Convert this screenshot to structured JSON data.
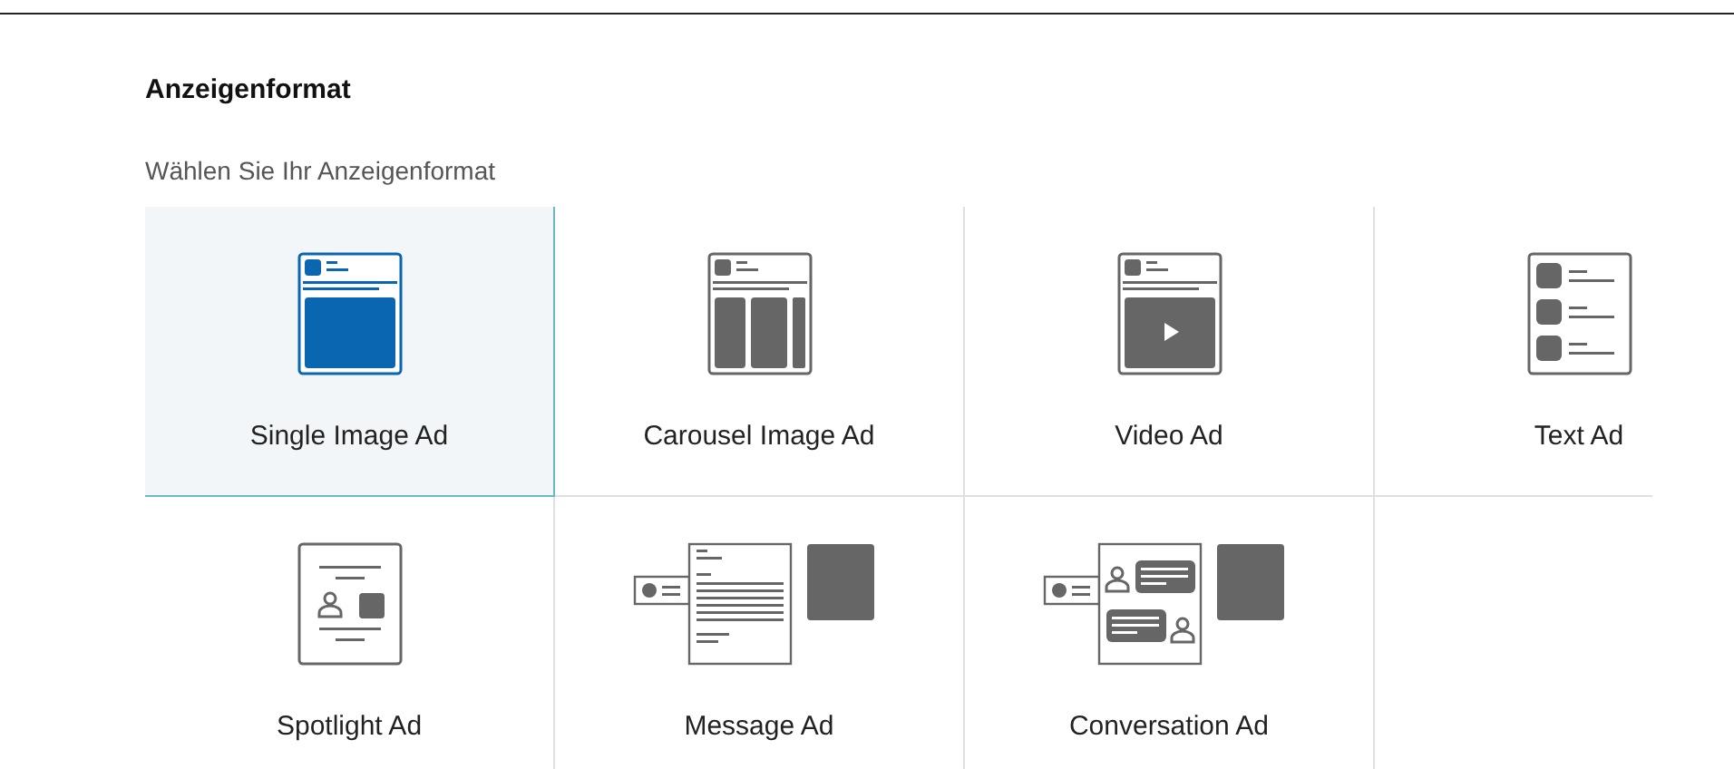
{
  "section": {
    "title": "Anzeigenformat",
    "subtitle": "Wählen Sie Ihr Anzeigenformat"
  },
  "formats": [
    {
      "kind": "single",
      "label": "Single Image Ad",
      "selected": true
    },
    {
      "kind": "carousel",
      "label": "Carousel Image Ad",
      "selected": false
    },
    {
      "kind": "video",
      "label": "Video Ad",
      "selected": false
    },
    {
      "kind": "text",
      "label": "Text Ad",
      "selected": false
    },
    {
      "kind": "spotlight",
      "label": "Spotlight Ad",
      "selected": false
    },
    {
      "kind": "message",
      "label": "Message Ad",
      "selected": false
    },
    {
      "kind": "conversation",
      "label": "Conversation Ad",
      "selected": false
    }
  ]
}
